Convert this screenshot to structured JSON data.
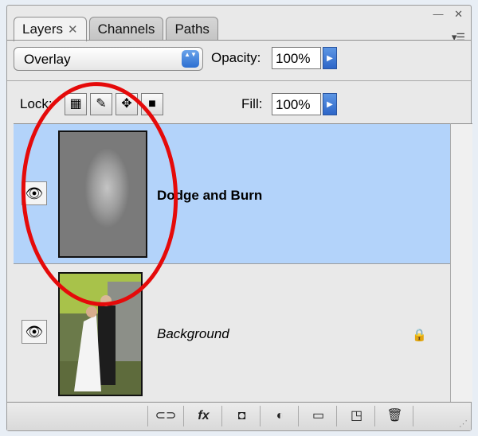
{
  "tabs": [
    {
      "label": "Layers",
      "close": "✕"
    },
    {
      "label": "Channels"
    },
    {
      "label": "Paths"
    }
  ],
  "window": {
    "minimize": "—",
    "close": "✕",
    "menu": "▾☰"
  },
  "blend_mode": {
    "value": "Overlay",
    "arrows": "▲▼"
  },
  "opacity": {
    "label": "Opacity:",
    "value": "100%",
    "arrow": "▶"
  },
  "lock": {
    "label": "Lock:",
    "icons": [
      "lock-transparent-icon",
      "lock-image-icon",
      "lock-position-icon",
      "lock-all-icon"
    ]
  },
  "fill": {
    "label": "Fill:",
    "value": "100%",
    "arrow": "▶"
  },
  "layers": [
    {
      "name": "Dodge and Burn",
      "selected": true,
      "visible": true,
      "style": "bold"
    },
    {
      "name": "Background",
      "selected": false,
      "visible": true,
      "style": "italic",
      "locked": true
    }
  ],
  "bottom_buttons": [
    {
      "name": "link-layers-icon",
      "glyph": "⊂⊃"
    },
    {
      "name": "layer-style-icon",
      "glyph": "fx"
    },
    {
      "name": "layer-mask-icon",
      "glyph": "◘"
    },
    {
      "name": "adjustment-layer-icon",
      "glyph": "◐"
    },
    {
      "name": "new-group-icon",
      "glyph": "▭"
    },
    {
      "name": "new-layer-icon",
      "glyph": "◳"
    },
    {
      "name": "delete-layer-icon",
      "glyph": "🗑"
    }
  ],
  "colors": {
    "selection": "#b3d3fa",
    "annotation": "#e50a0a",
    "accent_blue": "#2c6fd1"
  }
}
